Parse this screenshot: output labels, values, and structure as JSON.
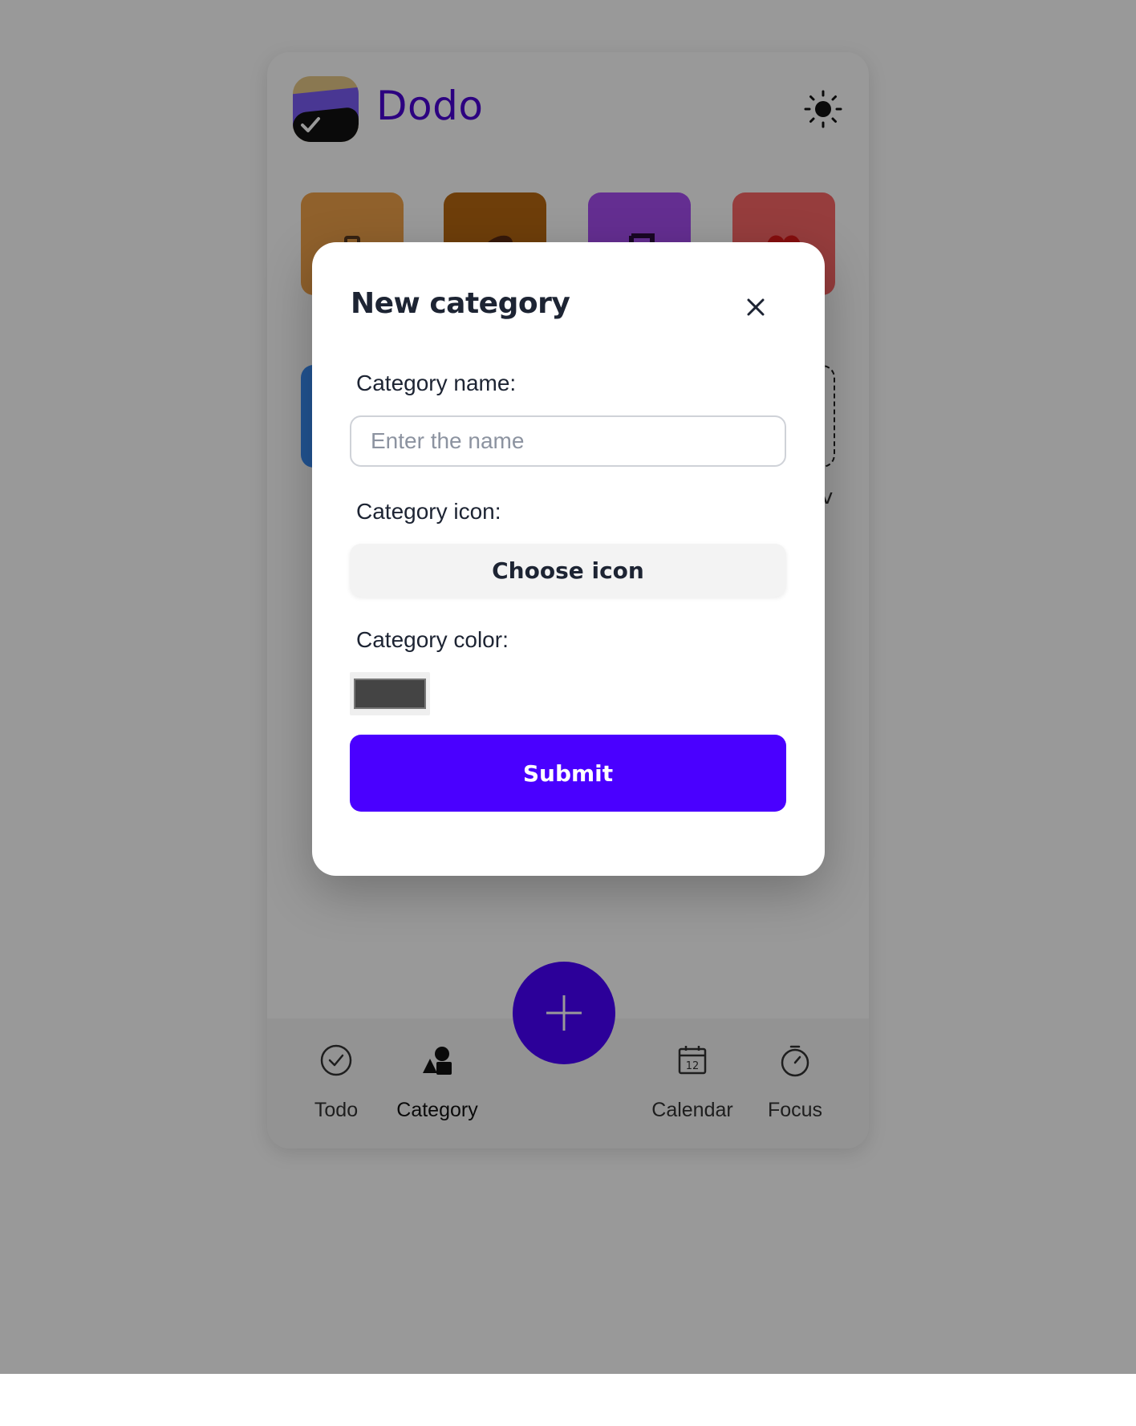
{
  "app": {
    "title": "Dodo",
    "accent_color": "#4a00ff",
    "title_color": "#4a00d6",
    "theme_toggle_icon": "sun-icon"
  },
  "categories_preview": [
    {
      "icon": "briefcase-icon",
      "color": "#f0a24a"
    },
    {
      "icon": "football-icon",
      "color": "#b86812"
    },
    {
      "icon": "music-note-icon",
      "color": "#a74df2"
    },
    {
      "icon": "heart-icon",
      "color": "#fb6767"
    },
    {
      "icon": "unknown-icon",
      "color": "#3a8cf5"
    }
  ],
  "new_tile_label": "v",
  "bottom_nav": {
    "items": [
      {
        "label": "Todo",
        "icon": "check-circle-icon",
        "active": false
      },
      {
        "label": "Category",
        "icon": "shapes-icon",
        "active": true
      },
      {
        "label": "Calendar",
        "icon": "calendar-icon",
        "active": false
      },
      {
        "label": "Focus",
        "icon": "stopwatch-icon",
        "active": false
      }
    ],
    "fab_icon": "plus-icon"
  },
  "modal": {
    "title": "New category",
    "close_icon": "close-icon",
    "name_label": "Category name:",
    "name_placeholder": "Enter the name",
    "name_value": "",
    "icon_label": "Category icon:",
    "choose_icon_label": "Choose icon",
    "color_label": "Category color:",
    "color_value": "#444444",
    "submit_label": "Submit"
  }
}
